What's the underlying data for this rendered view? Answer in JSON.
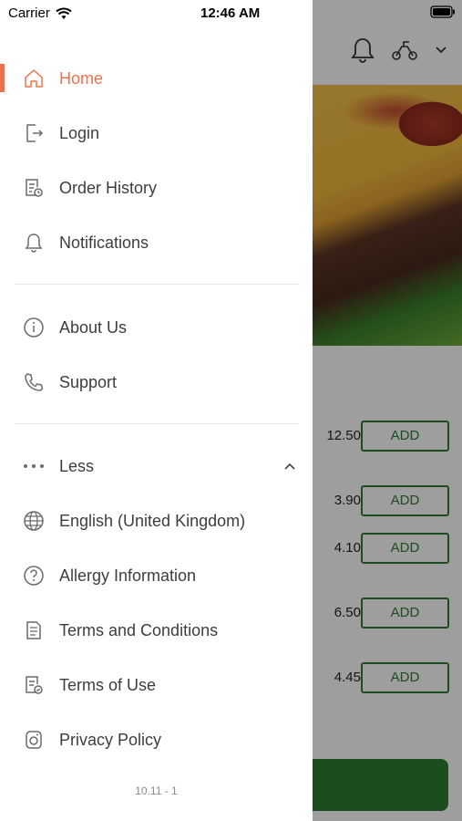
{
  "status_bar": {
    "carrier": "Carrier",
    "time": "12:46 AM"
  },
  "drawer": {
    "primary_items": [
      {
        "label": "Home",
        "icon": "home-icon",
        "active": true
      },
      {
        "label": "Login",
        "icon": "login-icon"
      },
      {
        "label": "Order History",
        "icon": "order-history-icon"
      },
      {
        "label": "Notifications",
        "icon": "bell-icon"
      }
    ],
    "secondary_items": [
      {
        "label": "About Us",
        "icon": "info-icon"
      },
      {
        "label": "Support",
        "icon": "phone-icon"
      }
    ],
    "more_toggle": {
      "label": "Less",
      "icon": "more-dots-icon",
      "chevron": "chevron-up-icon"
    },
    "extra_items": [
      {
        "label": "English (United Kingdom)",
        "icon": "globe-icon"
      },
      {
        "label": "Allergy Information",
        "icon": "question-icon"
      },
      {
        "label": "Terms and Conditions",
        "icon": "document-icon"
      },
      {
        "label": "Terms of Use",
        "icon": "document-check-icon"
      },
      {
        "label": "Privacy Policy",
        "icon": "privacy-icon"
      }
    ],
    "version": "10.11 - 1"
  },
  "background": {
    "header_icons": [
      "bell-icon",
      "scooter-icon",
      "chevron-down-icon"
    ],
    "menu_rows": [
      {
        "price": "12.50",
        "button": "ADD"
      },
      {
        "price": "3.90",
        "button": "ADD"
      },
      {
        "price": "4.10",
        "button": "ADD"
      },
      {
        "price": "6.50",
        "button": "ADD"
      },
      {
        "price": "4.45",
        "button": "ADD"
      }
    ],
    "accent_color": "#2e7d32"
  },
  "colors": {
    "active": "#e8734f",
    "text": "#3d3d3d",
    "icon": "#6b6b6b"
  }
}
